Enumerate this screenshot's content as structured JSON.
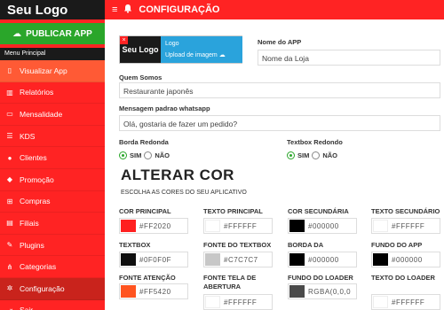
{
  "sidebar": {
    "logo": "Seu Logo",
    "publish_label": "PUBLICAR APP",
    "menu_header": "Menu Principal",
    "items": [
      {
        "label": "Visualizar App",
        "icon": "phone-icon",
        "glyph": "▯"
      },
      {
        "label": "Relatórios",
        "icon": "bar-chart-icon",
        "glyph": "▥"
      },
      {
        "label": "Mensalidade",
        "icon": "card-icon",
        "glyph": "▭"
      },
      {
        "label": "KDS",
        "icon": "list-icon",
        "glyph": "☰"
      },
      {
        "label": "Clientes",
        "icon": "user-icon",
        "glyph": "●"
      },
      {
        "label": "Promoção",
        "icon": "tag-icon",
        "glyph": "◆"
      },
      {
        "label": "Compras",
        "icon": "cart-icon",
        "glyph": "⊞"
      },
      {
        "label": "Filiais",
        "icon": "building-icon",
        "glyph": "▤"
      },
      {
        "label": "Plugins",
        "icon": "plug-icon",
        "glyph": "✎"
      },
      {
        "label": "Categorias",
        "icon": "sitemap-icon",
        "glyph": "⋔"
      },
      {
        "label": "Configuração",
        "icon": "gear-icon",
        "glyph": "✲"
      },
      {
        "label": "Sair",
        "icon": "exit-icon",
        "glyph": "⇥"
      }
    ]
  },
  "topbar": {
    "title": "CONFIGURAÇÃO",
    "menu_glyph": "≡",
    "bell_glyph": "🔔"
  },
  "form": {
    "logo_caption": "Logo",
    "logo_thumb_text": "Seu Logo",
    "upload_label": "Upload de imagem ☁",
    "app_name_label": "Nome do APP",
    "app_name_value": "Nome da Loja",
    "about_label": "Quem Somos",
    "about_value": "Restaurante japonês",
    "whatsapp_label": "Mensagem padrao whatsapp",
    "whatsapp_value": "Olá, gostaria de fazer um pedido?",
    "border_label": "Borda Redonda",
    "textbox_label": "Textbox Redondo",
    "yes": "SIM",
    "no": "NÃO"
  },
  "colors_section": {
    "title": "ALTERAR COR",
    "subtitle": "ESCOLHA AS CORES DO SEU APLICATIVO",
    "fields": [
      {
        "label": "COR PRINCIPAL",
        "value": "#FF2020",
        "swatch": "#ff2020"
      },
      {
        "label": "TEXTO PRINCIPAL",
        "value": "#FFFFFF",
        "swatch": "#ffffff"
      },
      {
        "label": "COR SECUNDÁRIA",
        "value": "#000000",
        "swatch": "#000000"
      },
      {
        "label": "TEXTO SECUNDÁRIO",
        "value": "#FFFFFF",
        "swatch": "#ffffff"
      },
      {
        "label": "TEXTBOX",
        "value": "#0F0F0F",
        "swatch": "#0f0f0f"
      },
      {
        "label": "FONTE DO TEXTBOX",
        "value": "#C7C7C7",
        "swatch": "#c7c7c7"
      },
      {
        "label": "BORDA DA CATEGORIA",
        "value": "#000000",
        "swatch": "#000000"
      },
      {
        "label": "FUNDO DO APP",
        "value": "#000000",
        "swatch": "#000000"
      },
      {
        "label": "FONTE ATENÇÃO",
        "value": "#FF5420",
        "swatch": "#ff5420"
      },
      {
        "label": "FONTE TELA DE ABERTURA",
        "value": "#FFFFFF",
        "swatch": "#ffffff"
      },
      {
        "label": "FUNDO DO LOADER",
        "value": "RGBA(0,0,0",
        "swatch": "#4a4a4a"
      },
      {
        "label": "TEXTO DO LOADER",
        "value": "#FFFFFF",
        "swatch": "#ffffff"
      }
    ]
  }
}
